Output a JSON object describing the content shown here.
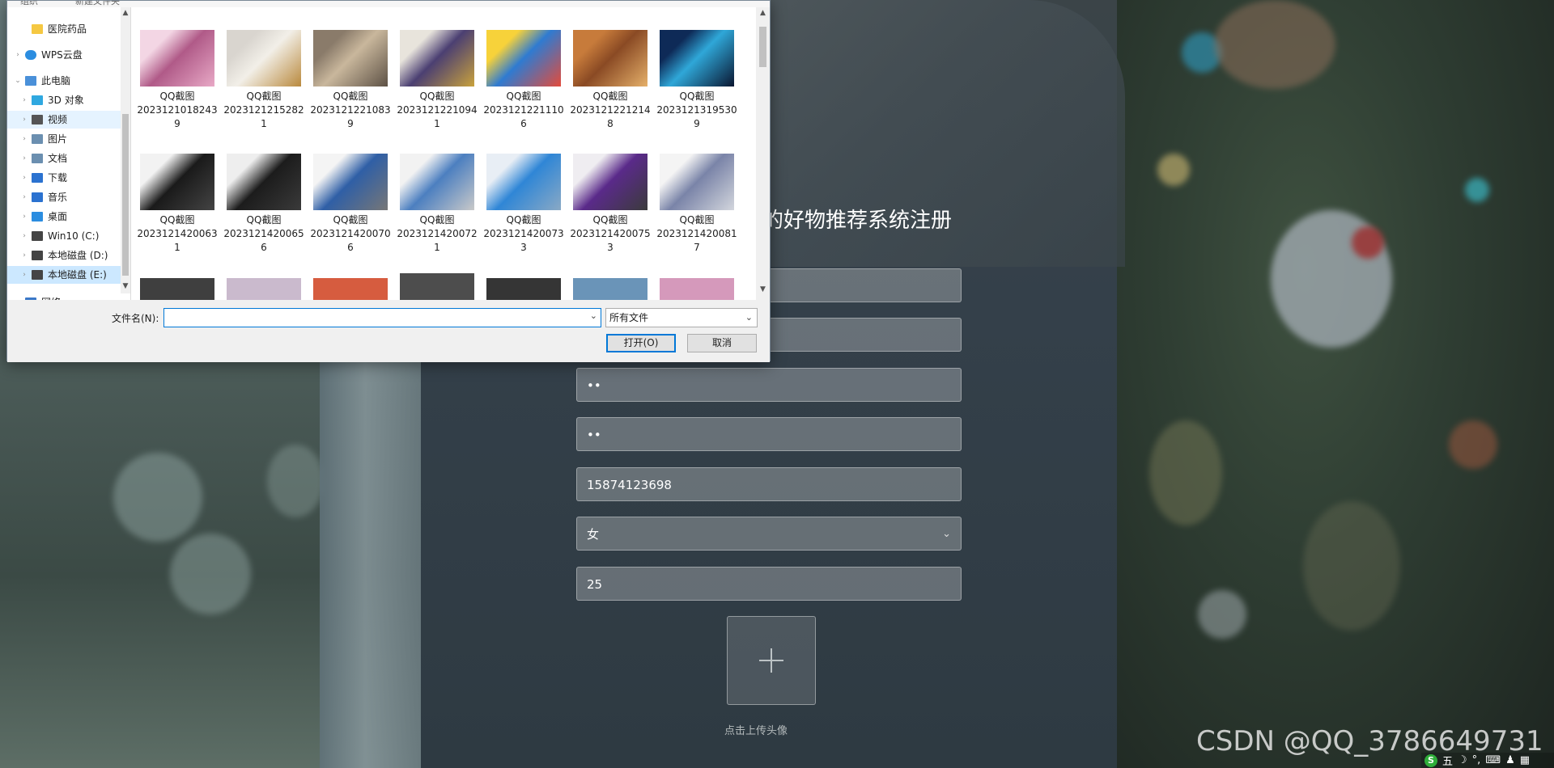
{
  "registration": {
    "title": "的好物推荐系统注册",
    "fields": {
      "password_value": "••",
      "confirm_password_value": "••",
      "phone_value": "15874123698",
      "gender_value": "女",
      "age_value": "25"
    },
    "upload_label": "点击上传头像"
  },
  "watermark": "CSDN @QQ_3786649731",
  "tray": {
    "ime_label": "五"
  },
  "dialog": {
    "toolbar": {
      "organize": "组织",
      "new_folder": "新建文件夹"
    },
    "nav": [
      {
        "label": "医院药品",
        "icon": "folder-icon"
      },
      {
        "label": "WPS云盘",
        "icon": "cloud-icon"
      },
      {
        "label": "此电脑",
        "icon": "computer-icon"
      },
      {
        "label": "3D 对象",
        "icon": "cube-icon"
      },
      {
        "label": "视频",
        "icon": "video-icon"
      },
      {
        "label": "图片",
        "icon": "picture-icon"
      },
      {
        "label": "文档",
        "icon": "document-icon"
      },
      {
        "label": "下载",
        "icon": "download-icon"
      },
      {
        "label": "音乐",
        "icon": "music-icon"
      },
      {
        "label": "桌面",
        "icon": "desktop-icon"
      },
      {
        "label": "Win10 (C:)",
        "icon": "drive-c-icon"
      },
      {
        "label": "本地磁盘 (D:)",
        "icon": "drive-icon"
      },
      {
        "label": "本地磁盘 (E:)",
        "icon": "drive-icon"
      },
      {
        "label": "网络",
        "icon": "network-icon"
      }
    ],
    "files": [
      {
        "line1": "QQ截图",
        "line2": "2023121018243",
        "line3": "9"
      },
      {
        "line1": "QQ截图",
        "line2": "2023121215282",
        "line3": "1"
      },
      {
        "line1": "QQ截图",
        "line2": "2023121221083",
        "line3": "9"
      },
      {
        "line1": "QQ截图",
        "line2": "2023121221094",
        "line3": "1"
      },
      {
        "line1": "QQ截图",
        "line2": "2023121221110",
        "line3": "6"
      },
      {
        "line1": "QQ截图",
        "line2": "2023121221214",
        "line3": "8"
      },
      {
        "line1": "QQ截图",
        "line2": "2023121319530",
        "line3": "9"
      },
      {
        "line1": "QQ截图",
        "line2": "2023121420063",
        "line3": "1"
      },
      {
        "line1": "QQ截图",
        "line2": "2023121420065",
        "line3": "6"
      },
      {
        "line1": "QQ截图",
        "line2": "2023121420070",
        "line3": "6"
      },
      {
        "line1": "QQ截图",
        "line2": "2023121420072",
        "line3": "1"
      },
      {
        "line1": "QQ截图",
        "line2": "2023121420073",
        "line3": "3"
      },
      {
        "line1": "QQ截图",
        "line2": "2023121420075",
        "line3": "3"
      },
      {
        "line1": "QQ截图",
        "line2": "2023121420081",
        "line3": "7"
      }
    ],
    "filename_label": "文件名(N):",
    "filename_value": "",
    "filetype_value": "所有文件",
    "open_button": "打开(O)",
    "cancel_button": "取消"
  },
  "colors": {
    "accent": "#0078d7",
    "dialog_bg": "#f0f0f0",
    "form_field": "rgba(255,255,255,0.26)"
  }
}
